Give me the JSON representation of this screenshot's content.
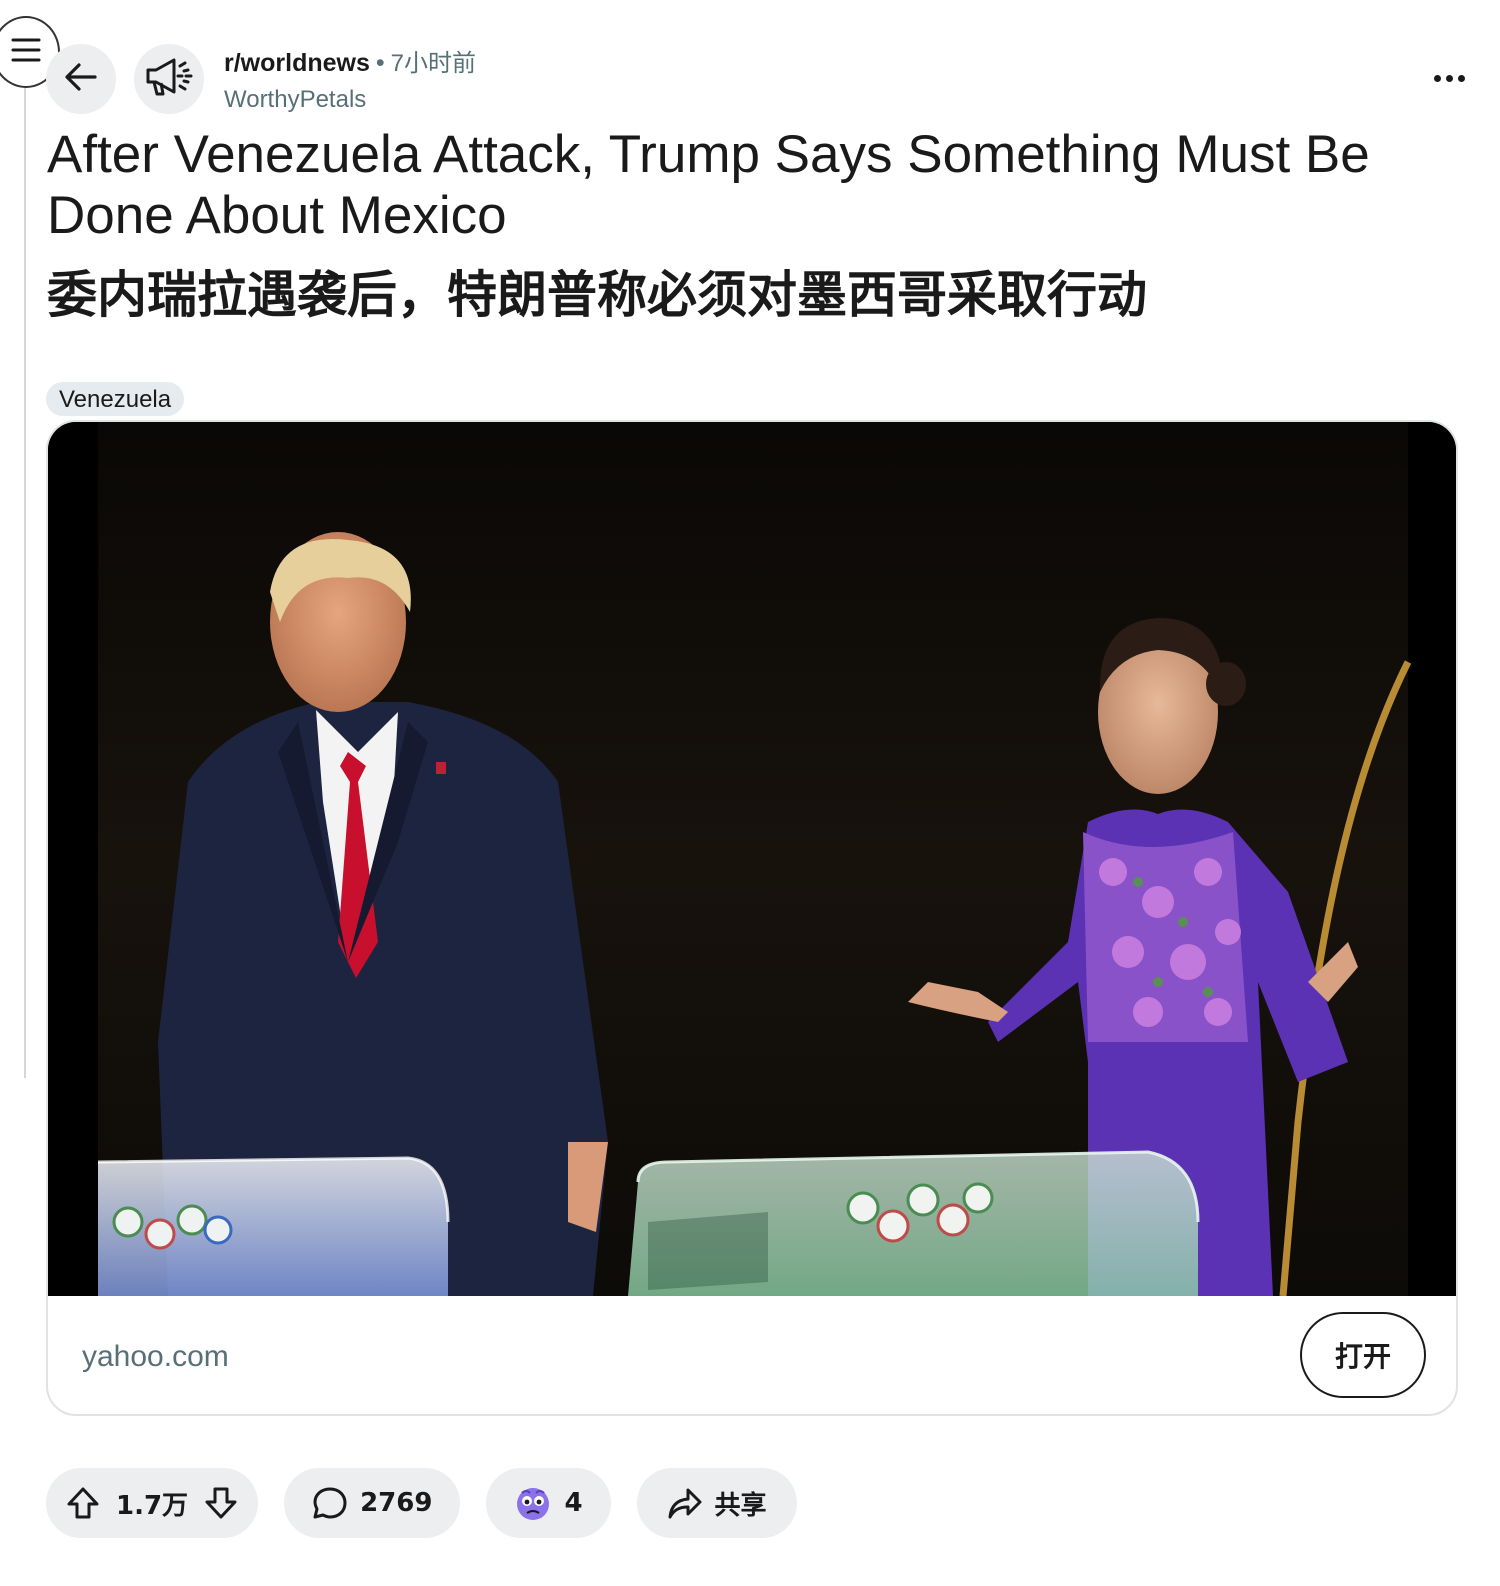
{
  "header": {
    "subreddit": "r/worldnews",
    "separator": "•",
    "time_ago": "7小时前",
    "author": "WorthyPetals"
  },
  "post": {
    "title_en": "After Venezuela Attack, Trump Says Something Must Be Done About Mexico",
    "title_zh": "委内瑞拉遇袭后，特朗普称必须对墨西哥采取行动",
    "flair": "Venezuela"
  },
  "link_card": {
    "domain": "yahoo.com",
    "open_label": "打开"
  },
  "actions": {
    "vote_count": "1.7万",
    "comment_count": "2769",
    "award_count": "4",
    "share_label": "共享"
  },
  "icons": {
    "menu": "hamburger-icon",
    "back": "back-arrow-icon",
    "subreddit": "megaphone-icon",
    "more": "more-horizontal-icon",
    "upvote": "upvote-arrow-icon",
    "downvote": "downvote-arrow-icon",
    "comment": "comment-bubble-icon",
    "award": "award-face-icon",
    "share": "share-arrow-icon"
  },
  "colors": {
    "text": "#1a1a1b",
    "muted": "#576f76",
    "pill_bg": "#eceef0",
    "flair_bg": "#e5ebee",
    "tie_red": "#c8102e",
    "dress_purple": "#5b32b4"
  }
}
